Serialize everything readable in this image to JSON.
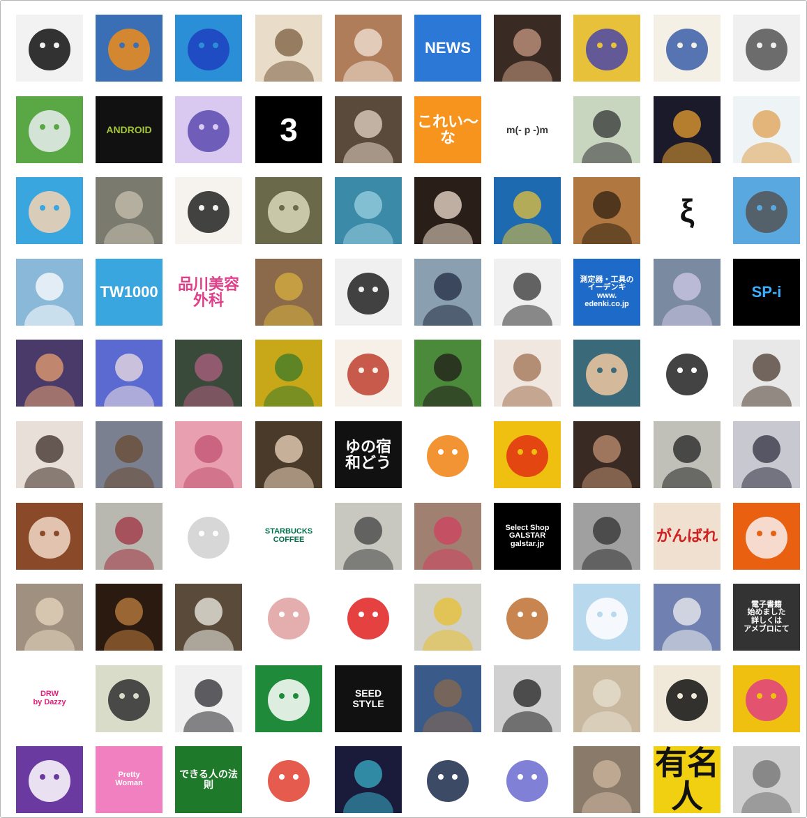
{
  "grid": {
    "columns": 10,
    "tiles": [
      {
        "icon": "vinyl-record-icon",
        "bg": "#f2f2f2",
        "fg": "#111111",
        "label": ""
      },
      {
        "icon": "pumpkin-icon",
        "bg": "#3b6fb5",
        "fg": "#f08c1a",
        "label": ""
      },
      {
        "icon": "blue-mascot-icon",
        "bg": "#2b8fd8",
        "fg": "#1d3fbf",
        "label": ""
      },
      {
        "icon": "person-glasses-photo",
        "bg": "#e9dcc9",
        "fg": "#7a5c3e",
        "label": ""
      },
      {
        "icon": "dog-photo",
        "bg": "#b07d5a",
        "fg": "#f3e6d8",
        "label": ""
      },
      {
        "icon": "news-button-icon",
        "bg": "#2b78d6",
        "fg": "#ffffff",
        "label": "NEWS"
      },
      {
        "icon": "two-people-photo",
        "bg": "#3a2a24",
        "fg": "#c89a82",
        "label": ""
      },
      {
        "icon": "colorful-anime-illustration",
        "bg": "#e8c13a",
        "fg": "#4b47a8",
        "label": ""
      },
      {
        "icon": "cartoon-man-icon",
        "bg": "#f5f0e6",
        "fg": "#3a5da8",
        "label": ""
      },
      {
        "icon": "sketch-drawing-icon",
        "bg": "#f0f0f0",
        "fg": "#555555",
        "label": ""
      },
      {
        "icon": "green-character-icon",
        "bg": "#5aa845",
        "fg": "#e9eef0",
        "label": ""
      },
      {
        "icon": "android-icon",
        "bg": "#111111",
        "fg": "#a4c639",
        "label": "ANDROID"
      },
      {
        "icon": "anime-girl-icon",
        "bg": "#d9c9f0",
        "fg": "#5b4bb0",
        "label": ""
      },
      {
        "icon": "number-three-icon",
        "bg": "#000000",
        "fg": "#ffffff",
        "label": "3"
      },
      {
        "icon": "man-drinking-photo",
        "bg": "#5a4a3c",
        "fg": "#e6d6c6",
        "label": ""
      },
      {
        "icon": "music-note-icon",
        "bg": "#f7941d",
        "fg": "#ffffff",
        "label": "これい～な"
      },
      {
        "icon": "emoticon-text-icon",
        "bg": "#ffffff",
        "fg": "#333333",
        "label": "m(- p -)m"
      },
      {
        "icon": "photo-collage-icon",
        "bg": "#c8d6c0",
        "fg": "#333333",
        "label": ""
      },
      {
        "icon": "city-night-photo",
        "bg": "#1a1a2a",
        "fg": "#e8a030",
        "label": ""
      },
      {
        "icon": "sleeping-cat-photo",
        "bg": "#eef3f6",
        "fg": "#e0a050",
        "label": ""
      },
      {
        "icon": "cartoon-mother-child-icon",
        "bg": "#3aa6e0",
        "fg": "#f6d2b0",
        "label": ""
      },
      {
        "icon": "cat-face-photo",
        "bg": "#7a7a6e",
        "fg": "#c9c2b2",
        "label": ""
      },
      {
        "icon": "stamp-logo-icon",
        "bg": "#f6f3ee",
        "fg": "#222222",
        "label": ""
      },
      {
        "icon": "skull-poster-icon",
        "bg": "#6a6a4a",
        "fg": "#d8d8b8",
        "label": ""
      },
      {
        "icon": "dolphin-photo",
        "bg": "#3a8aa8",
        "fg": "#9cd0e0",
        "label": ""
      },
      {
        "icon": "lamps-photo",
        "bg": "#2a1e18",
        "fg": "#f0e0d0",
        "label": ""
      },
      {
        "icon": "sea-turtle-photo",
        "bg": "#1e6ab0",
        "fg": "#e6c23a",
        "label": ""
      },
      {
        "icon": "laughing-man-photo",
        "bg": "#b07840",
        "fg": "#302010",
        "label": ""
      },
      {
        "icon": "xi-character-icon",
        "bg": "#ffffff",
        "fg": "#111111",
        "label": "ξ"
      },
      {
        "icon": "moai-statue-icon",
        "bg": "#5aa8e0",
        "fg": "#555555",
        "label": ""
      },
      {
        "icon": "soccer-ball-photo",
        "bg": "#8ab8d8",
        "fg": "#ffffff",
        "label": ""
      },
      {
        "icon": "girl-avatar-icon",
        "bg": "#3aa6e0",
        "fg": "#ffffff",
        "label": "TW1000"
      },
      {
        "icon": "clinic-name-icon",
        "bg": "#ffffff",
        "fg": "#e0408a",
        "label": "品川美容外科"
      },
      {
        "icon": "trophy-photo",
        "bg": "#8a6a4a",
        "fg": "#d8b040",
        "label": ""
      },
      {
        "icon": "manga-man-icon",
        "bg": "#f0f0f0",
        "fg": "#222222",
        "label": ""
      },
      {
        "icon": "businessman-photo",
        "bg": "#8aa0b0",
        "fg": "#202a40",
        "label": ""
      },
      {
        "icon": "figure-toy-photo",
        "bg": "#f0f0f0",
        "fg": "#333333",
        "label": ""
      },
      {
        "icon": "edenki-ad-icon",
        "bg": "#1e6ac8",
        "fg": "#ffffff",
        "label": "測定器・工具の\nイーデンキ\nwww.\nedenki.co.jp"
      },
      {
        "icon": "decorated-cup-photo",
        "bg": "#7a8aa0",
        "fg": "#d0c8e8",
        "label": ""
      },
      {
        "icon": "spi-logo-icon",
        "bg": "#000000",
        "fg": "#3ab0ff",
        "label": "SP-i"
      },
      {
        "icon": "sunset-city-photo",
        "bg": "#4a3a6a",
        "fg": "#e8a070",
        "label": ""
      },
      {
        "icon": "singer-photo",
        "bg": "#5a6ad0",
        "fg": "#f0e0e0",
        "label": ""
      },
      {
        "icon": "car-interior-photo",
        "bg": "#3a4a3a",
        "fg": "#b06080",
        "label": ""
      },
      {
        "icon": "yellow-tulips-photo",
        "bg": "#c8a818",
        "fg": "#3a7a2a",
        "label": ""
      },
      {
        "icon": "chopsticks-illustration",
        "bg": "#f6f0e8",
        "fg": "#c04030",
        "label": ""
      },
      {
        "icon": "businessman-green-photo",
        "bg": "#4a8a3a",
        "fg": "#201a18",
        "label": ""
      },
      {
        "icon": "woman-portrait-photo",
        "bg": "#f0e8e0",
        "fg": "#a07050",
        "label": ""
      },
      {
        "icon": "cartoon-boy-icon",
        "bg": "#3a6a7a",
        "fg": "#f0c8a0",
        "label": ""
      },
      {
        "icon": "smiley-drawing-icon",
        "bg": "#ffffff",
        "fg": "#222222",
        "label": ""
      },
      {
        "icon": "man-portrait-photo",
        "bg": "#e8e8e8",
        "fg": "#4a3a30",
        "label": ""
      },
      {
        "icon": "girl-selfie-photo",
        "bg": "#e8e0d8",
        "fg": "#3a2a24",
        "label": ""
      },
      {
        "icon": "man-outdoor-photo",
        "bg": "#7a8090",
        "fg": "#6a4a30",
        "label": ""
      },
      {
        "icon": "cherry-blossom-photo",
        "bg": "#e8a0b0",
        "fg": "#c05070",
        "label": ""
      },
      {
        "icon": "man-bookshelf-photo",
        "bg": "#4a3a2a",
        "fg": "#f0d8c0",
        "label": ""
      },
      {
        "icon": "calligraphy-icon",
        "bg": "#111111",
        "fg": "#ffffff",
        "label": "ゆの宿\n和どう"
      },
      {
        "icon": "orange-mascot-icon",
        "bg": "#ffffff",
        "fg": "#f08010",
        "label": ""
      },
      {
        "icon": "yellow-monster-icon",
        "bg": "#f0c010",
        "fg": "#e03010",
        "label": ""
      },
      {
        "icon": "man-dark-photo",
        "bg": "#3a2a24",
        "fg": "#c09070",
        "label": ""
      },
      {
        "icon": "guitar-player-photo",
        "bg": "#c0c0b8",
        "fg": "#202020",
        "label": ""
      },
      {
        "icon": "man-tie-photo",
        "bg": "#c8c8d0",
        "fg": "#303040",
        "label": ""
      },
      {
        "icon": "anime-brown-hair-icon",
        "bg": "#8a4a2a",
        "fg": "#f0d8c8",
        "label": ""
      },
      {
        "icon": "two-people-wall-photo",
        "bg": "#b8b8b0",
        "fg": "#a03040",
        "label": ""
      },
      {
        "icon": "golf-ball-icon",
        "bg": "#ffffff",
        "fg": "#d0d0d0",
        "label": ""
      },
      {
        "icon": "starbucks-logo-icon",
        "bg": "#ffffff",
        "fg": "#00704a",
        "label": "STARBUCKS COFFEE"
      },
      {
        "icon": "schnauzer-photo",
        "bg": "#c8c8c0",
        "fg": "#404040",
        "label": ""
      },
      {
        "icon": "woman-flowers-photo",
        "bg": "#a08070",
        "fg": "#d04060",
        "label": ""
      },
      {
        "icon": "galstar-logo-icon",
        "bg": "#000000",
        "fg": "#ffffff",
        "label": "Select Shop\nGALSTAR\ngalstar.jp"
      },
      {
        "icon": "floor-object-photo",
        "bg": "#a0a0a0",
        "fg": "#303030",
        "label": ""
      },
      {
        "icon": "ganbare-sign-photo",
        "bg": "#f0e0d0",
        "fg": "#d02020",
        "label": "がんばれ"
      },
      {
        "icon": "cartoon-hat-girl-icon",
        "bg": "#e86010",
        "fg": "#f8f0f0",
        "label": ""
      },
      {
        "icon": "dog-cage-photo",
        "bg": "#a09080",
        "fg": "#e8d8c0",
        "label": ""
      },
      {
        "icon": "twigs-photo",
        "bg": "#2a1a10",
        "fg": "#c08040",
        "label": ""
      },
      {
        "icon": "white-dog-photo",
        "bg": "#5a4a3a",
        "fg": "#f0f0e8",
        "label": ""
      },
      {
        "icon": "pig-soccer-mascot-icon",
        "bg": "#ffffff",
        "fg": "#e0a0a0",
        "label": ""
      },
      {
        "icon": "tomato-mascot-icon",
        "bg": "#ffffff",
        "fg": "#e02020",
        "label": ""
      },
      {
        "icon": "office-room-photo",
        "bg": "#d0d0c8",
        "fg": "#e8c030",
        "label": ""
      },
      {
        "icon": "rilakkuma-icon",
        "bg": "#ffffff",
        "fg": "#c07030",
        "label": ""
      },
      {
        "icon": "twitter-bird-light-icon",
        "bg": "#b8d8ee",
        "fg": "#ffffff",
        "label": ""
      },
      {
        "icon": "snowy-house-photo",
        "bg": "#7080b0",
        "fg": "#f0f0f0",
        "label": ""
      },
      {
        "icon": "ebook-text-icon",
        "bg": "#333333",
        "fg": "#ffffff",
        "label": "電子書籍\n始めました\n詳しくは\nアメブロにて"
      },
      {
        "icon": "drw-logo-icon",
        "bg": "#ffffff",
        "fg": "#e0207a",
        "label": "DRW\nby Dazzy"
      },
      {
        "icon": "anime-boy-sketch-icon",
        "bg": "#d8dcc8",
        "fg": "#303030",
        "label": ""
      },
      {
        "icon": "man-suit-photo",
        "bg": "#f0f0f0",
        "fg": "#2a2a30",
        "label": ""
      },
      {
        "icon": "exit-sign-icon",
        "bg": "#1e8a3a",
        "fg": "#ffffff",
        "label": ""
      },
      {
        "icon": "seed-style-logo-icon",
        "bg": "#111111",
        "fg": "#ffffff",
        "label": "SEED\nSTYLE"
      },
      {
        "icon": "landscape-rock-photo",
        "bg": "#3a5a8a",
        "fg": "#8a6a4a",
        "label": ""
      },
      {
        "icon": "computer-desk-photo",
        "bg": "#d0d0d0",
        "fg": "#202020",
        "label": ""
      },
      {
        "icon": "hamster-photo",
        "bg": "#c8b8a0",
        "fg": "#e8e0d0",
        "label": ""
      },
      {
        "icon": "manga-panel-icon",
        "bg": "#f0e8d8",
        "fg": "#101010",
        "label": ""
      },
      {
        "icon": "heart-pattern-icon",
        "bg": "#f0c010",
        "fg": "#e04080",
        "label": ""
      },
      {
        "icon": "twitter-bird-purple-icon",
        "bg": "#6a3aa0",
        "fg": "#ffffff",
        "label": ""
      },
      {
        "icon": "pretty-woman-logo-icon",
        "bg": "#f080c0",
        "fg": "#ffffff",
        "label": "Pretty\nWoman"
      },
      {
        "icon": "book-cover-icon",
        "bg": "#1e7a2a",
        "fg": "#ffffff",
        "label": "できる人の法則"
      },
      {
        "icon": "cartoon-girl-icon",
        "bg": "#ffffff",
        "fg": "#e04030",
        "label": ""
      },
      {
        "icon": "planetarium-photo",
        "bg": "#1a1a3a",
        "fg": "#3ab0c8",
        "label": ""
      },
      {
        "icon": "logo-badge-icon",
        "bg": "#ffffff",
        "fg": "#1a2a4a",
        "label": ""
      },
      {
        "icon": "anime-cat-girl-icon",
        "bg": "#ffffff",
        "fg": "#6a6ad0",
        "label": ""
      },
      {
        "icon": "faces-cookies-photo",
        "bg": "#8a7a6a",
        "fg": "#d0b8a0",
        "label": ""
      },
      {
        "icon": "yumeijin-text-icon",
        "bg": "#f0d010",
        "fg": "#111111",
        "label": "有名人"
      },
      {
        "icon": "shop-front-photo",
        "bg": "#d0d0d0",
        "fg": "#707070",
        "label": ""
      }
    ]
  }
}
